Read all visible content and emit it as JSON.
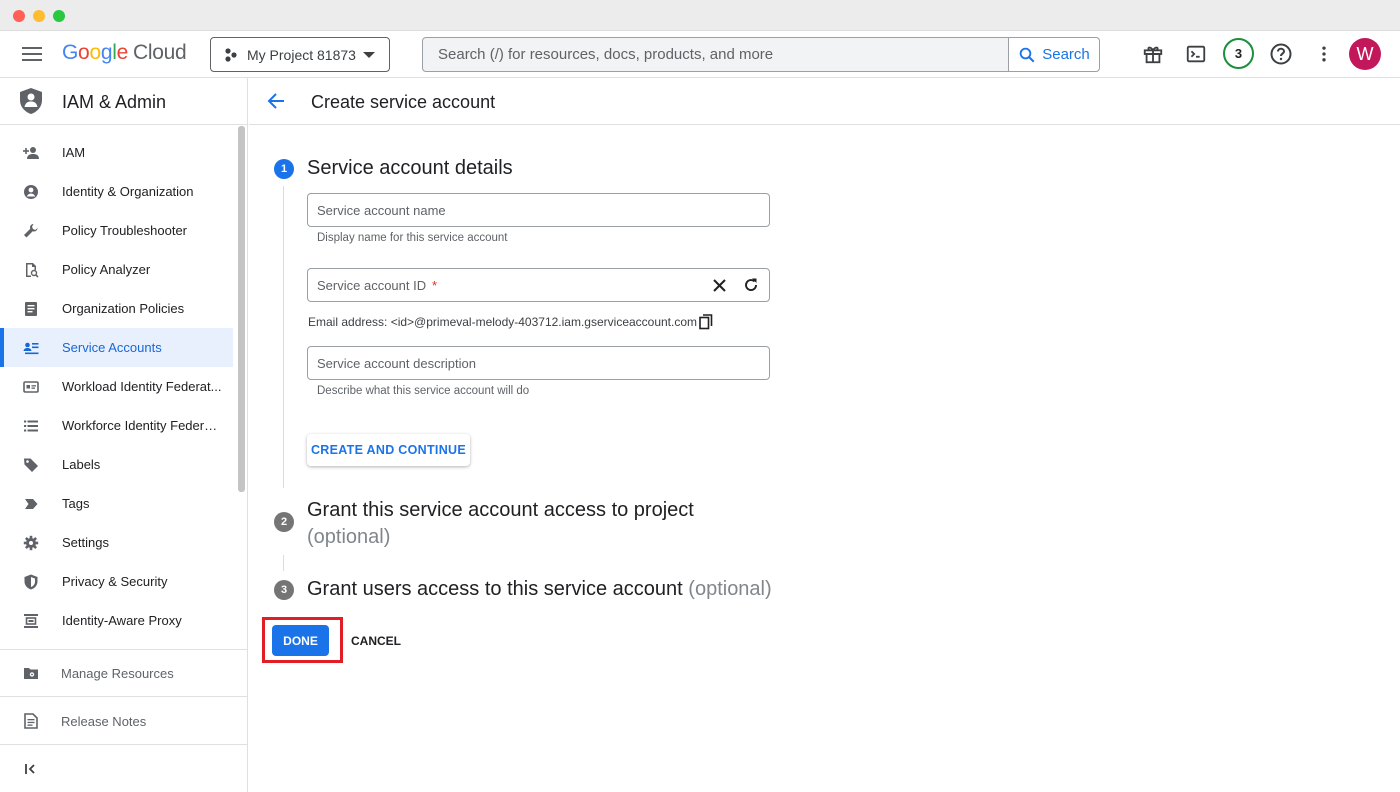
{
  "header": {
    "logo_google": "Google",
    "logo_cloud": "Cloud",
    "project_name": "My Project 81873",
    "search_placeholder": "Search (/) for resources, docs, products, and more",
    "search_button": "Search",
    "notifications_count": "3",
    "avatar_initial": "W"
  },
  "sidebar": {
    "title": "IAM & Admin",
    "items": [
      {
        "label": "IAM",
        "icon": "person-add-icon"
      },
      {
        "label": "Identity & Organization",
        "icon": "account-circle-icon"
      },
      {
        "label": "Policy Troubleshooter",
        "icon": "wrench-icon"
      },
      {
        "label": "Policy Analyzer",
        "icon": "document-search-icon"
      },
      {
        "label": "Organization Policies",
        "icon": "policy-document-icon"
      },
      {
        "label": "Service Accounts",
        "icon": "service-account-icon"
      },
      {
        "label": "Workload Identity Federat...",
        "icon": "id-card-icon"
      },
      {
        "label": "Workforce Identity Federa...",
        "icon": "list-icon"
      },
      {
        "label": "Labels",
        "icon": "label-icon"
      },
      {
        "label": "Tags",
        "icon": "tag-icon"
      },
      {
        "label": "Settings",
        "icon": "gear-icon"
      },
      {
        "label": "Privacy & Security",
        "icon": "shield-icon"
      },
      {
        "label": "Identity-Aware Proxy",
        "icon": "proxy-icon"
      }
    ],
    "active_index": 5,
    "manage_resources": "Manage Resources",
    "release_notes": "Release Notes"
  },
  "main": {
    "page_title": "Create service account",
    "step1": {
      "number": "1",
      "title": "Service account details",
      "name_placeholder": "Service account name",
      "name_hint": "Display name for this service account",
      "id_placeholder": "Service account ID",
      "id_required": "*",
      "email_line": "Email address: <id>@primeval-melody-403712.iam.gserviceaccount.com",
      "description_placeholder": "Service account description",
      "description_hint": "Describe what this service account will do",
      "create_button": "CREATE AND CONTINUE"
    },
    "step2": {
      "number": "2",
      "title": "Grant this service account access to project",
      "optional": "(optional)"
    },
    "step3": {
      "number": "3",
      "title": "Grant users access to this service account",
      "optional": "(optional)"
    },
    "done_button": "DONE",
    "cancel_button": "CANCEL"
  },
  "colors": {
    "accent": "#1a73e8",
    "highlight": "#e11d25",
    "avatar": "#c2185b",
    "badge_border": "#1e8e3e"
  }
}
